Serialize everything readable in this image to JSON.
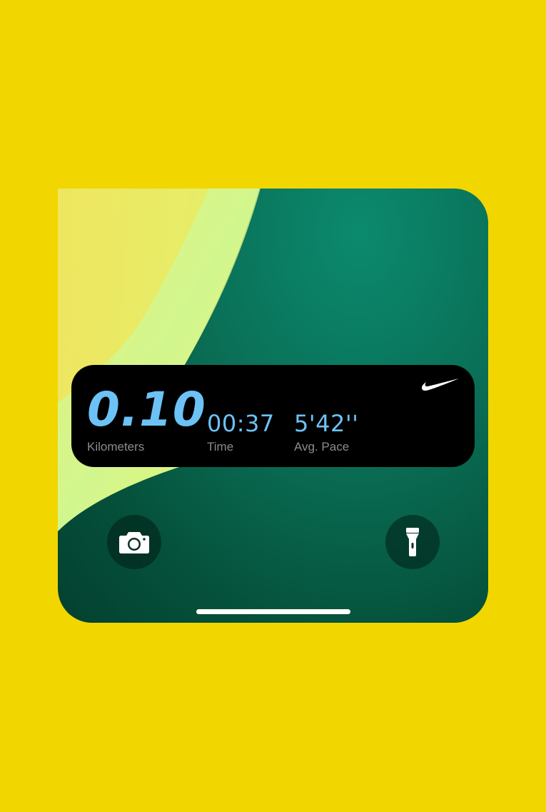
{
  "colors": {
    "background": "#f2d600",
    "widget_background": "#000000",
    "metric_value": "#6cc2f4",
    "metric_label": "#8c8c8c",
    "wallpaper_green": "#0a6e55",
    "wallpaper_lime": "#d4f78c"
  },
  "live_activity": {
    "brand_icon": "nike-swoosh-icon",
    "distance": {
      "value": "0.10",
      "label": "Kilometers"
    },
    "time": {
      "value": "00:37",
      "label": "Time"
    },
    "pace": {
      "value": "5'42''",
      "label": "Avg. Pace"
    }
  },
  "lock_screen": {
    "camera_icon": "camera-icon",
    "flashlight_icon": "flashlight-icon"
  }
}
